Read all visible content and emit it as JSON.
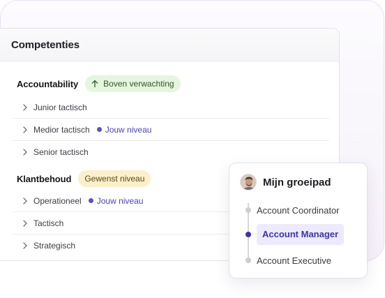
{
  "competencies": {
    "title": "Competenties",
    "groups": [
      {
        "label": "Accountability",
        "badge": "Boven verwachting",
        "rows": [
          {
            "label": "Junior tactisch"
          },
          {
            "label": "Medior tactisch",
            "tag": "Jouw niveau"
          },
          {
            "label": "Senior tactisch"
          }
        ]
      },
      {
        "label": "Klantbehoud",
        "badge": "Gewenst niveau",
        "rows": [
          {
            "label": "Operationeel",
            "tag": "Jouw niveau"
          },
          {
            "label": "Tactisch"
          },
          {
            "label": "Strategisch"
          }
        ]
      }
    ]
  },
  "growth_path": {
    "title": "Mijn groeipad",
    "steps": [
      "Account Coordinator",
      "Account Manager",
      "Account Executive"
    ],
    "active_step": "Account Manager"
  },
  "colors": {
    "accent": "#3d35a3",
    "badge_green": "#e5f5df",
    "badge_yellow": "#fbefcc"
  }
}
